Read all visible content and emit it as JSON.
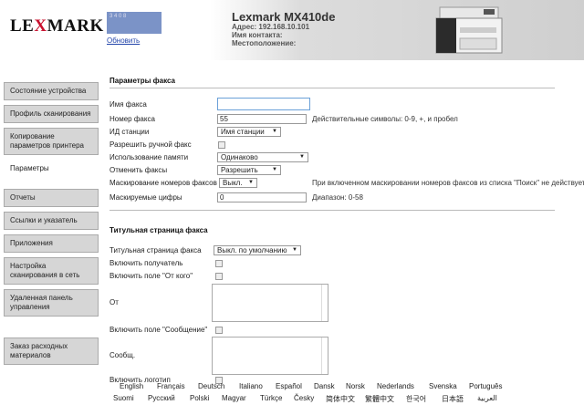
{
  "header": {
    "logo": "LEXMARK",
    "status_text": "3 4 0 8",
    "refresh_link": "Обновить",
    "model": "Lexmark MX410de",
    "address": "Адрес: 192.168.10.101",
    "contact": "Имя контакта:",
    "location": "Местоположение:"
  },
  "sidebar": {
    "items": [
      {
        "label": "Состояние устройства"
      },
      {
        "label": "Профиль сканирования"
      },
      {
        "label": "Копирование параметров принтера"
      },
      {
        "label": "Параметры"
      },
      {
        "label": "Отчеты"
      },
      {
        "label": "Ссылки и указатель"
      },
      {
        "label": "Приложения"
      },
      {
        "label": "Настройка сканирования в сеть"
      },
      {
        "label": "Удаленная панель управления"
      },
      {
        "label": "Заказ расходных материалов"
      }
    ]
  },
  "fax": {
    "section_title": "Параметры факса",
    "fax_name_label": "Имя факса",
    "fax_name_value": "",
    "fax_number_label": "Номер факса",
    "fax_number_value": "55",
    "fax_number_hint": "Действительные символы: 0-9, +, и пробел",
    "station_id_label": "ИД станции",
    "station_id_value": "Имя станции",
    "manual_fax_label": "Разрешить ручной факс",
    "memory_use_label": "Использование памяти",
    "memory_use_value": "Одинаково",
    "cancel_faxes_label": "Отменить факсы",
    "cancel_faxes_value": "Разрешить",
    "masking_label": "Маскирование номеров факсов",
    "masking_value": "Выкл.",
    "masking_hint": "При включенном маскировании номеров факсов из списка \"Поиск\" не действует.",
    "digits_label": "Маскируемые цифры",
    "digits_value": "0",
    "digits_hint": "Диапазон: 0-58"
  },
  "cover": {
    "section_title": "Титульная страница факса",
    "cover_page_label": "Титульная страница факса",
    "cover_page_value": "Выкл. по умолчанию",
    "include_to_label": "Включить получатель",
    "include_from_label": "Включить поле \"От кого\"",
    "from_label": "От",
    "include_message_label": "Включить поле \"Сообщение\"",
    "message_label": "Сообщ.",
    "include_logo_label": "Включить логотип"
  },
  "languages": {
    "row1": [
      "English",
      "Français",
      "Deutsch",
      "Italiano",
      "Español",
      "Dansk",
      "Norsk",
      "Nederlands",
      "Svenska",
      "Português"
    ],
    "row2": [
      "Suomi",
      "Русский",
      "Polski",
      "Magyar",
      "Türkçe",
      "Česky",
      "简体中文",
      "繁體中文",
      "한국어",
      "日本語",
      "العربية"
    ]
  }
}
